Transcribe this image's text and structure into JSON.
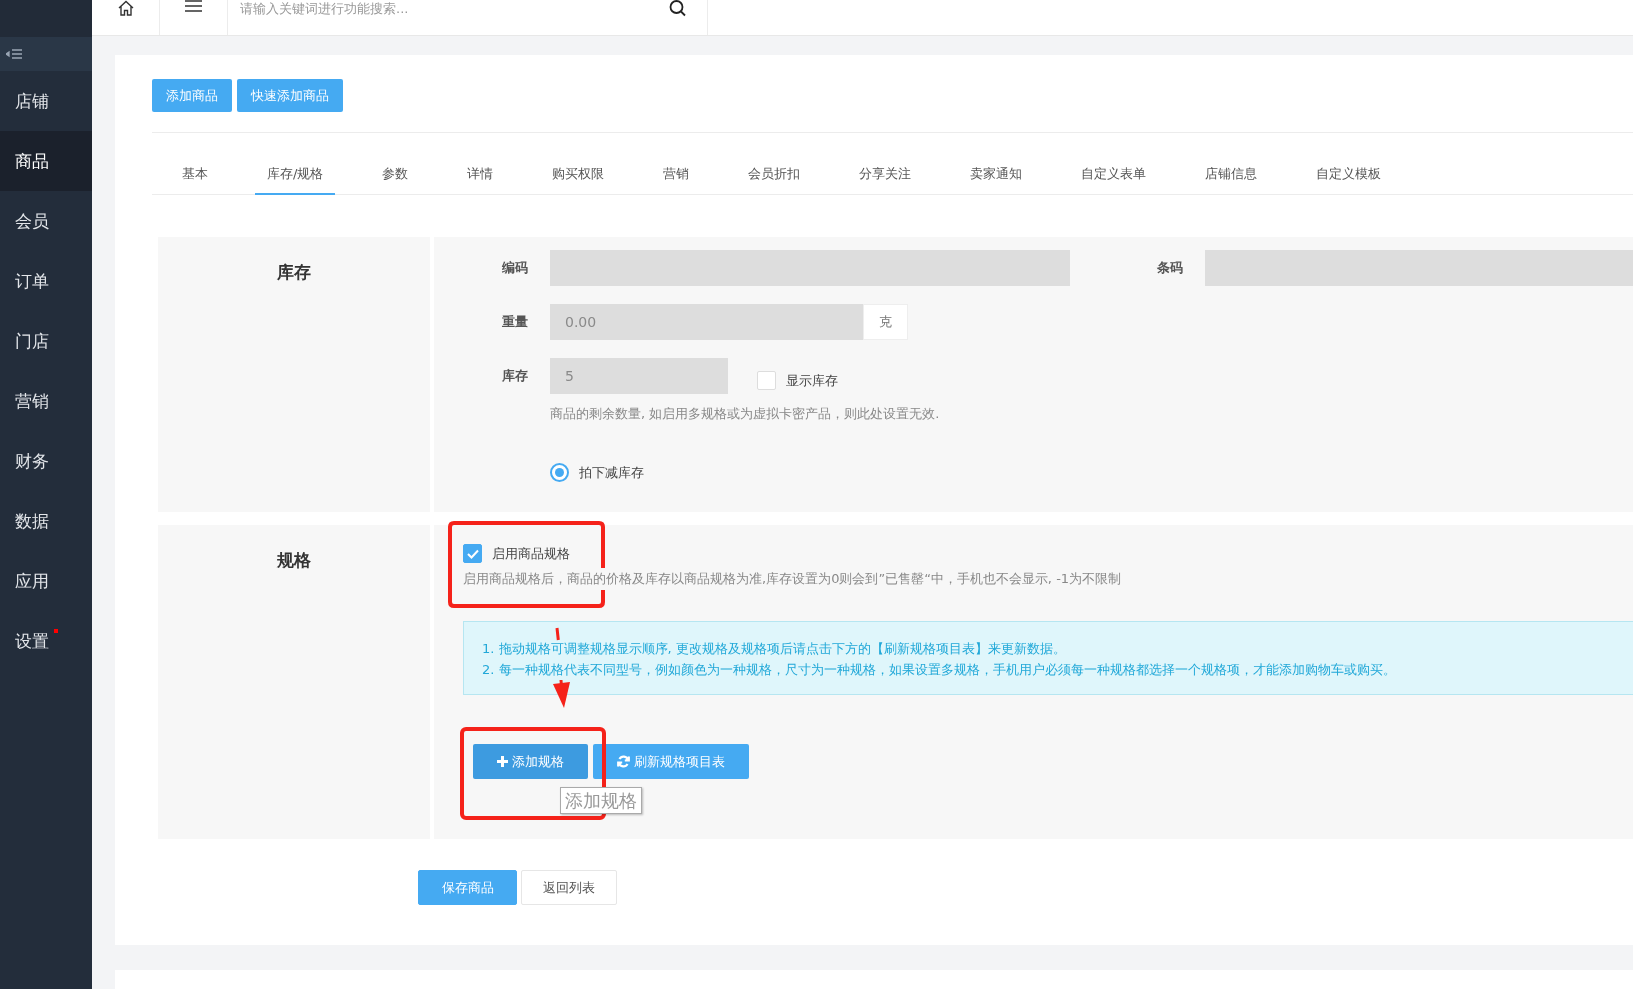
{
  "topbar": {
    "search": {
      "placeholder": "请输入关键词进行功能搜索..."
    }
  },
  "sidebar": {
    "items": [
      {
        "label": "店铺",
        "selected": false,
        "badge": false
      },
      {
        "label": "商品",
        "selected": true,
        "badge": false
      },
      {
        "label": "会员",
        "selected": false,
        "badge": false
      },
      {
        "label": "订单",
        "selected": false,
        "badge": false
      },
      {
        "label": "门店",
        "selected": false,
        "badge": false
      },
      {
        "label": "营销",
        "selected": false,
        "badge": false
      },
      {
        "label": "财务",
        "selected": false,
        "badge": false
      },
      {
        "label": "数据",
        "selected": false,
        "badge": false
      },
      {
        "label": "应用",
        "selected": false,
        "badge": false
      },
      {
        "label": "设置",
        "selected": false,
        "badge": true
      }
    ]
  },
  "actions": [
    "添加商品",
    "快速添加商品"
  ],
  "tabs": [
    {
      "label": "基本",
      "selected": false
    },
    {
      "label": "库存/规格",
      "selected": true
    },
    {
      "label": "参数",
      "selected": false
    },
    {
      "label": "详情",
      "selected": false
    },
    {
      "label": "购买权限",
      "selected": false
    },
    {
      "label": "营销",
      "selected": false
    },
    {
      "label": "会员折扣",
      "selected": false
    },
    {
      "label": "分享关注",
      "selected": false
    },
    {
      "label": "卖家通知",
      "selected": false
    },
    {
      "label": "自定义表单",
      "selected": false
    },
    {
      "label": "店铺信息",
      "selected": false
    },
    {
      "label": "自定义模板",
      "selected": false
    }
  ],
  "stock_section": {
    "title": "库存",
    "code": {
      "label": "编码"
    },
    "barcode": {
      "label": "条码"
    },
    "weight": {
      "label": "重量",
      "value": "0.00",
      "unit": "克"
    },
    "stock": {
      "label": "库存",
      "value": "5",
      "show_stock": {
        "label": "显示库存",
        "checked": false
      },
      "help": "商品的剩余数量, 如启用多规格或为虚拟卡密产品，则此处设置无效."
    },
    "reduce_on_order": {
      "label": "拍下减库存",
      "selected": true
    }
  },
  "spec_section": {
    "title": "规格",
    "enable": {
      "label": "启用商品规格",
      "checked": true
    },
    "help": "启用商品规格后，商品的价格及库存以商品规格为准,库存设置为0则会到”已售罄“中，手机也不会显示, -1为不限制",
    "notes": [
      "1. 拖动规格可调整规格显示顺序, 更改规格及规格项后请点击下方的【刷新规格项目表】来更新数据。",
      "2. 每一种规格代表不同型号，例如颜色为一种规格，尺寸为一种规格，如果设置多规格，手机用户必须每一种规格都选择一个规格项，才能添加购物车或购买。"
    ],
    "buttons": [
      {
        "label": "添加规格",
        "kind": "add",
        "hovered": true
      },
      {
        "label": "刷新规格项目表",
        "kind": "refresh",
        "hovered": false
      }
    ],
    "tooltip": "添加规格"
  },
  "footer_buttons": [
    {
      "label": "保存商品",
      "kind": "primary"
    },
    {
      "label": "返回列表",
      "kind": "default"
    }
  ]
}
